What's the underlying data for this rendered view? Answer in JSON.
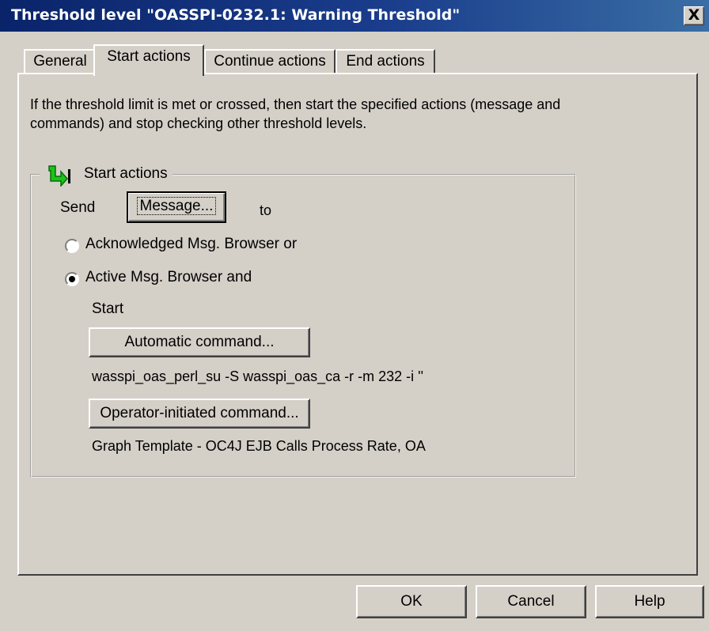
{
  "window": {
    "title": "Threshold level \"OASSPI-0232.1: Warning Threshold\"",
    "close_label": "X"
  },
  "tabs": [
    {
      "label": "General"
    },
    {
      "label": "Start actions",
      "active": true
    },
    {
      "label": "Continue actions"
    },
    {
      "label": "End actions"
    }
  ],
  "description": "If the threshold limit is met or crossed, then start the specified actions (message and commands) and stop checking other threshold levels.",
  "start_actions": {
    "group_label": "Start actions",
    "group_icon": "green-arrow-icon",
    "send_label": "Send",
    "message_button": "Message...",
    "to_label": "to",
    "radio_options": [
      {
        "label": "Acknowledged Msg. Browser or",
        "selected": false
      },
      {
        "label": "Active Msg. Browser and",
        "selected": true
      }
    ],
    "start_label": "Start",
    "automatic_command_button": "Automatic command...",
    "automatic_command_value": "wasspi_oas_perl_su -S wasspi_oas_ca -r -m 232 -i ''",
    "operator_command_button": "Operator-initiated command...",
    "operator_command_value": "Graph Template - OC4J EJB Calls Process Rate, OA"
  },
  "footer": {
    "ok_label": "OK",
    "cancel_label": "Cancel",
    "help_label": "Help"
  }
}
